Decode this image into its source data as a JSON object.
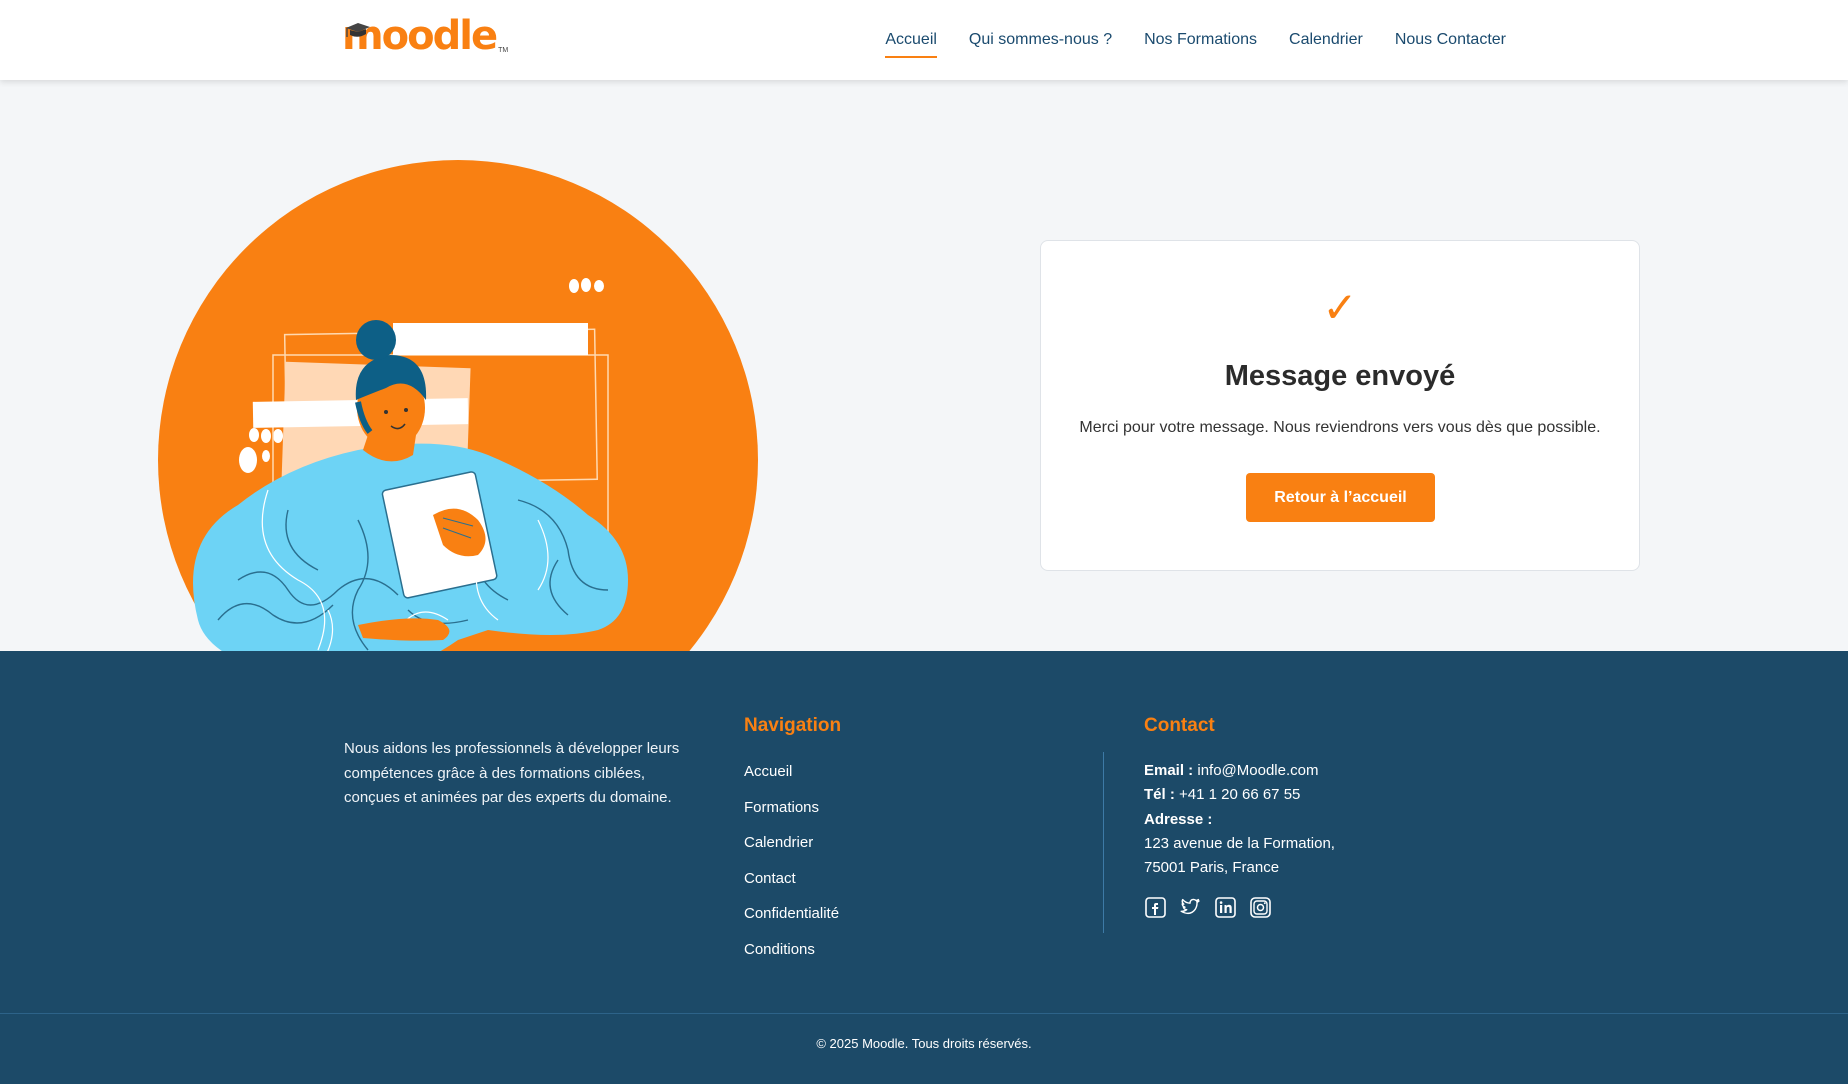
{
  "header": {
    "logo_text": "moodle",
    "logo_tm": "TM",
    "nav": [
      {
        "label": "Accueil",
        "active": true
      },
      {
        "label": "Qui sommes-nous ?",
        "active": false
      },
      {
        "label": "Nos Formations",
        "active": false
      },
      {
        "label": "Calendrier",
        "active": false
      },
      {
        "label": "Nous Contacter",
        "active": false
      }
    ]
  },
  "confirmation": {
    "check": "✓",
    "title": "Message envoyé",
    "text": "Merci pour votre message. Nous reviendrons vers vous dès que possible.",
    "button_label": "Retour à l’accueil"
  },
  "footer": {
    "about": "Nous aidons les professionnels à développer leurs compétences grâce à des formations ciblées, conçues et animées par des experts du domaine.",
    "nav_title": "Navigation",
    "nav_links": [
      "Accueil",
      "Formations",
      "Calendrier",
      "Contact",
      "Confidentialité",
      "Conditions"
    ],
    "contact_title": "Contact",
    "email_label": "Email :",
    "email_value": "info@Moodle.com",
    "phone_label": "Tél :",
    "phone_value": "+41 1 20 66 67 55",
    "address_label": "Adresse :",
    "address_line1": "123 avenue de la Formation,",
    "address_line2": "75001 Paris, France",
    "socials": [
      "facebook-icon",
      "twitter-icon",
      "linkedin-icon",
      "instagram-icon"
    ],
    "copyright": "© 2025 Moodle. Tous droits réservés."
  },
  "colors": {
    "accent": "#f98012",
    "navy": "#1c4a68",
    "link": "#1a4a6e",
    "illustration_blue": "#6dd3f5"
  }
}
